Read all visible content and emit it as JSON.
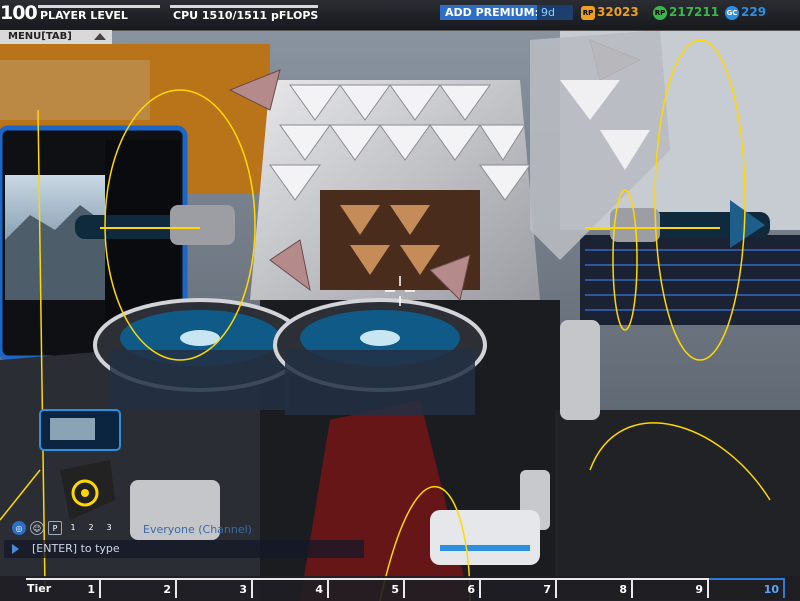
{
  "hud": {
    "level": "100",
    "level_label": "PLAYER LEVEL",
    "level_progress": 1.0,
    "cpu_text": "CPU  1510/1511 pFLOPS",
    "cpu_progress": 0.999,
    "premium_label": "ADD PREMIUM:",
    "premium_days": "9d",
    "robits": "32023",
    "robits_icon": "RP",
    "tech_points": "217211",
    "tech_icon": "RP",
    "cosmetic_credits": "229",
    "cosmetic_icon": "GC",
    "menu_label": "MENU[TAB]"
  },
  "chat": {
    "channel": "Everyone (Channel)",
    "input_hint": "[ENTER] to type",
    "icons": [
      "globe-icon",
      "team-icon",
      "party-icon",
      "1",
      "2",
      "3"
    ]
  },
  "tier": {
    "label": "Tier",
    "segments": [
      "1",
      "2",
      "3",
      "4",
      "5",
      "6",
      "7",
      "8",
      "9",
      "10"
    ],
    "active": "10"
  },
  "colors": {
    "accent_blue": "#2d6fc6",
    "robits": "#f0a020",
    "tech": "#3cb84a",
    "cosmetic": "#2d8fe0",
    "gizmo_yellow": "#ffd800"
  }
}
